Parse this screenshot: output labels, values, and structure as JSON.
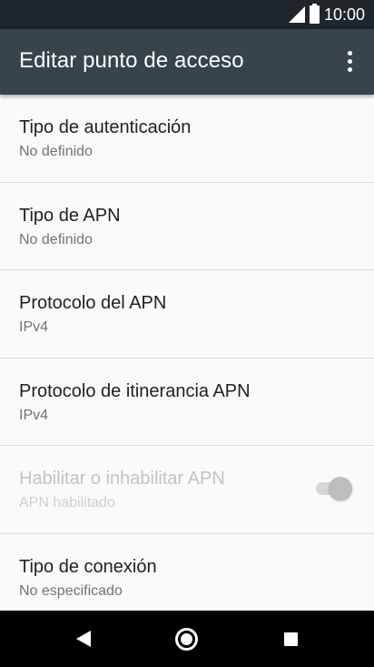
{
  "status_bar": {
    "time": "10:00",
    "signal_icon": "cell-signal-icon",
    "battery_icon": "battery-icon"
  },
  "app_bar": {
    "title": "Editar punto de acceso",
    "overflow_icon": "more-vert-icon"
  },
  "preferences": [
    {
      "title": "Tipo de autenticación",
      "summary": "No definido",
      "enabled": true
    },
    {
      "title": "Tipo de APN",
      "summary": "No definido",
      "enabled": true
    },
    {
      "title": "Protocolo del APN",
      "summary": "IPv4",
      "enabled": true
    },
    {
      "title": "Protocolo de itinerancia APN",
      "summary": "IPv4",
      "enabled": true
    },
    {
      "title": "Habilitar o inhabilitar APN",
      "summary": "APN habilitado",
      "enabled": false,
      "toggle_on": true
    },
    {
      "title": "Tipo de conexión",
      "summary": "No especificado",
      "enabled": true
    }
  ],
  "nav_bar": {
    "back_icon": "back-triangle-icon",
    "home_icon": "home-circle-icon",
    "recents_icon": "recents-square-icon"
  },
  "colors": {
    "status_bar": "#1f262b",
    "app_bar": "#37444c",
    "background": "#fafafa",
    "nav_bar": "#000000"
  }
}
